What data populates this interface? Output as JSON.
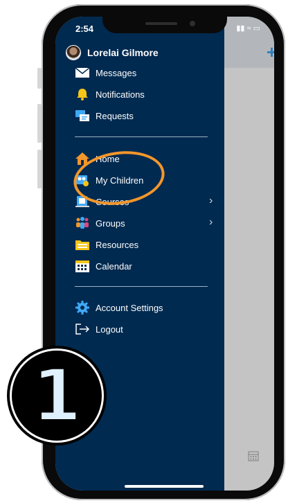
{
  "status_bar": {
    "time": "2:54"
  },
  "profile": {
    "name": "Lorelai Gilmore"
  },
  "menu": {
    "section1": [
      {
        "label": "Messages",
        "icon": "envelope-icon"
      },
      {
        "label": "Notifications",
        "icon": "bell-icon"
      },
      {
        "label": "Requests",
        "icon": "requests-icon"
      }
    ],
    "section2": [
      {
        "label": "Home",
        "icon": "home-icon"
      },
      {
        "label": "My Children",
        "icon": "children-icon"
      },
      {
        "label": "Courses",
        "icon": "courses-icon",
        "chevron": true
      },
      {
        "label": "Groups",
        "icon": "groups-icon",
        "chevron": true
      },
      {
        "label": "Resources",
        "icon": "folder-icon"
      },
      {
        "label": "Calendar",
        "icon": "calendar-icon"
      }
    ],
    "section3": [
      {
        "label": "Account Settings",
        "icon": "gear-icon"
      },
      {
        "label": "Logout",
        "icon": "logout-icon"
      }
    ]
  },
  "annotation": {
    "step_number": "1",
    "highlight_color": "#f3962b"
  },
  "colors": {
    "drawer_bg": "#002a50",
    "accent": "#2a7fc0"
  }
}
